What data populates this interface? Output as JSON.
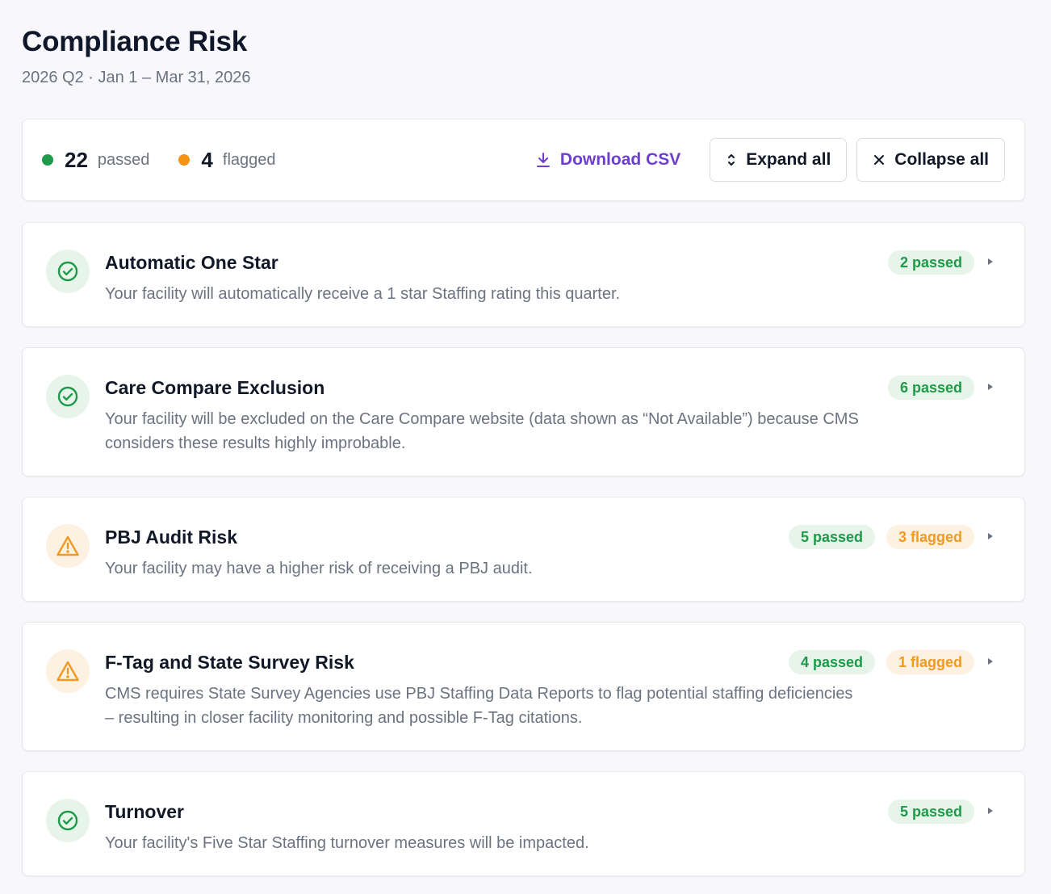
{
  "header": {
    "title": "Compliance Risk",
    "subtitle": "2026 Q2 · Jan 1 – Mar 31, 2026"
  },
  "summary": {
    "passed_count": "22",
    "passed_label": "passed",
    "flagged_count": "4",
    "flagged_label": "flagged",
    "download_label": "Download CSV",
    "expand_label": "Expand all",
    "collapse_label": "Collapse all"
  },
  "colors": {
    "passed": "#1e9a4a",
    "flagged": "#ef9a22",
    "accent": "#6d3fd0"
  },
  "cards": [
    {
      "status": "ok",
      "icon": "check-circle-icon",
      "title": "Automatic One Star",
      "description": "Your facility will automatically receive a 1 star Staffing rating this quarter.",
      "passed": "2 passed",
      "flagged": null
    },
    {
      "status": "ok",
      "icon": "check-circle-icon",
      "title": "Care Compare Exclusion",
      "description": "Your facility will be excluded on the Care Compare website (data shown as “Not Available”) because CMS considers these results highly improbable.",
      "passed": "6 passed",
      "flagged": null
    },
    {
      "status": "warn",
      "icon": "warning-triangle-icon",
      "title": "PBJ Audit Risk",
      "description": "Your facility may have a higher risk of receiving a PBJ audit.",
      "passed": "5 passed",
      "flagged": "3 flagged"
    },
    {
      "status": "warn",
      "icon": "warning-triangle-icon",
      "title": "F-Tag and State Survey Risk",
      "description": "CMS requires State Survey Agencies use PBJ Staffing Data Reports to flag potential staffing deficiencies – resulting in closer facility monitoring and possible F-Tag citations.",
      "passed": "4 passed",
      "flagged": "1 flagged"
    },
    {
      "status": "ok",
      "icon": "check-circle-icon",
      "title": "Turnover",
      "description": "Your facility's Five Star Staffing turnover measures will be impacted.",
      "passed": "5 passed",
      "flagged": null
    }
  ]
}
